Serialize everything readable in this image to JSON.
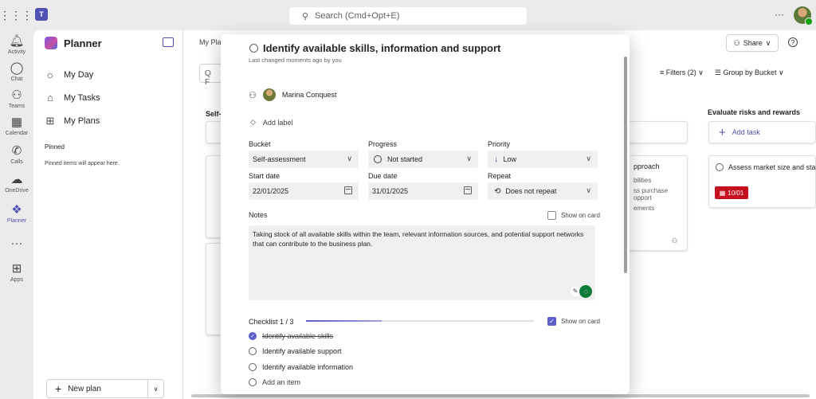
{
  "topbar": {
    "search_placeholder": "Search (Cmd+Opt+E)",
    "more": "···"
  },
  "rail": [
    {
      "label": "Activity",
      "icon": "bell-icon"
    },
    {
      "label": "Chat",
      "icon": "chat-icon"
    },
    {
      "label": "Teams",
      "icon": "teams-icon"
    },
    {
      "label": "Calendar",
      "icon": "calendar-icon"
    },
    {
      "label": "Calls",
      "icon": "phone-icon"
    },
    {
      "label": "OneDrive",
      "icon": "cloud-icon"
    },
    {
      "label": "Planner",
      "icon": "planner-icon"
    },
    {
      "label": "···",
      "icon": "more-icon"
    },
    {
      "label": "Apps",
      "icon": "apps-icon"
    }
  ],
  "sidebar": {
    "title": "Planner",
    "items": [
      {
        "label": "My Day"
      },
      {
        "label": "My Tasks"
      },
      {
        "label": "My Plans"
      }
    ],
    "pinned_header": "Pinned",
    "pinned_empty": "Pinned items will appear here.",
    "new_plan": "New plan"
  },
  "board": {
    "crumb": "My Pla",
    "filter_stub": "Q F",
    "bucket_left": "Self-",
    "share": "Share",
    "filters": "Filters (2)",
    "group_by": "Group by Bucket",
    "bucket_right": "Evaluate risks and rewards",
    "add_task": "Add task",
    "card_right_title": "Assess market size and stab",
    "card_right_due": "10/01",
    "card_mid_title": "pproach",
    "card_mid_l1": "bilities",
    "card_mid_l2": "ss purchase opport",
    "card_mid_l3": "ements"
  },
  "task": {
    "title": "Identify available skills, information and support",
    "changed": "Last changed moments ago by you",
    "assignee": "Marina Conquest",
    "add_label": "Add label",
    "bucket_label": "Bucket",
    "bucket_value": "Self-assessment",
    "progress_label": "Progress",
    "progress_value": "Not started",
    "priority_label": "Priority",
    "priority_value": "Low",
    "start_label": "Start date",
    "start_value": "22/01/2025",
    "due_label": "Due date",
    "due_value": "31/01/2025",
    "repeat_label": "Repeat",
    "repeat_value": "Does not repeat",
    "notes_label": "Notes",
    "show_on_card": "Show on card",
    "notes_text": "Taking stock of all available skills within the team, relevant information sources, and potential support networks that can contribute to the business plan.",
    "checklist_label": "Checklist 1 / 3",
    "checklist_progress": 0.3333,
    "checklist": [
      {
        "text": "Identify available skills",
        "done": true
      },
      {
        "text": "Identify available support",
        "done": false
      },
      {
        "text": "Identify available information",
        "done": false
      }
    ],
    "add_item": "Add an item",
    "accent": "#5b5fc7"
  }
}
